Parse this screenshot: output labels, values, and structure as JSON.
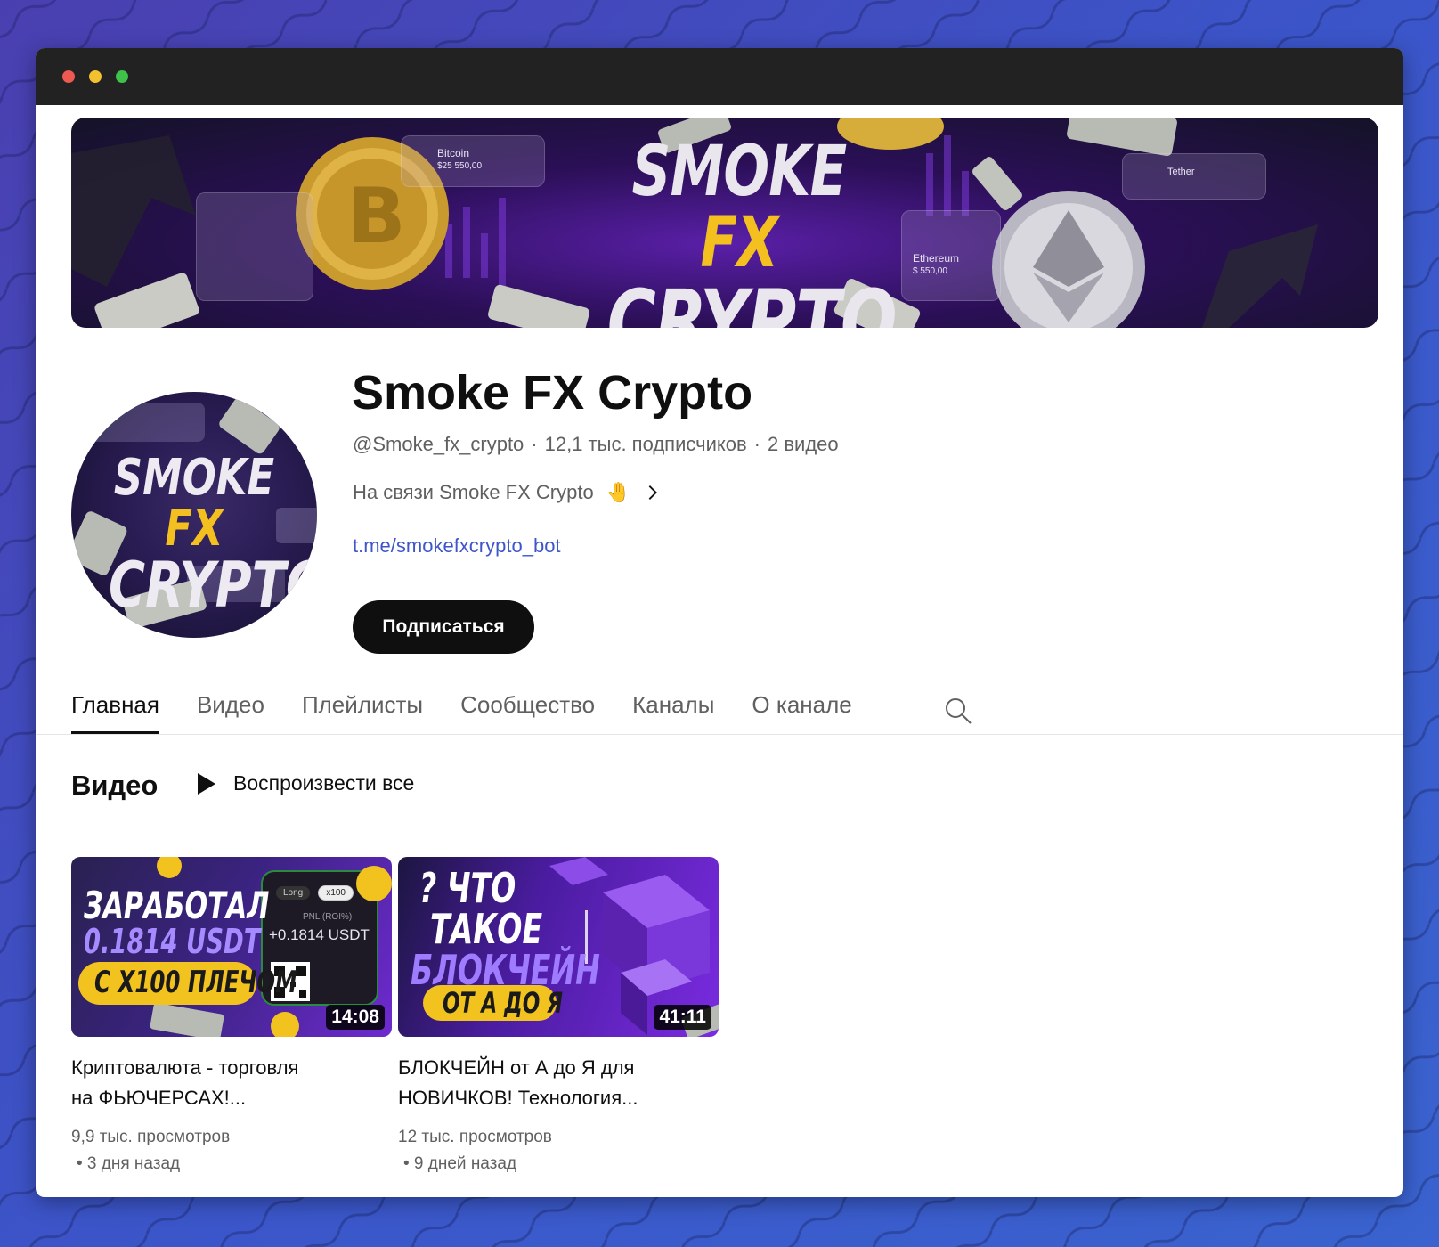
{
  "banner": {
    "title_line1_a": "SMOKE ",
    "title_line1_b": "FX",
    "title_line2": "CRYPTO",
    "card_bitcoin_name": "Bitcoin",
    "card_bitcoin_price": "$25 550,00",
    "card_ethereum_name": "Ethereum",
    "card_ethereum_price": "$ 550,00",
    "card_tether_name": "Tether"
  },
  "avatar": {
    "title_line1_a": "SMOKE ",
    "title_line1_b": "FX",
    "title_line2": "CRYPTO"
  },
  "channel": {
    "name": "Smoke FX Crypto",
    "handle": "@Smoke_fx_crypto",
    "subscribers": "12,1 тыс. подписчиков",
    "videos_count": "2 видео",
    "separator": "·",
    "description": "На связи Smoke FX Crypto",
    "description_emoji": "🤚",
    "link": "t.me/smokefxcrypto_bot",
    "subscribe_label": "Подписаться"
  },
  "tabs": [
    {
      "label": "Главная",
      "active": true
    },
    {
      "label": "Видео"
    },
    {
      "label": "Плейлисты"
    },
    {
      "label": "Сообщество"
    },
    {
      "label": "Каналы"
    },
    {
      "label": "О канале"
    }
  ],
  "section": {
    "title": "Видео",
    "play_all_label": "Воспроизвести все"
  },
  "videos": [
    {
      "thumb_line1": "ЗАРАБОТАЛ",
      "thumb_line2": "0.1814 USDT",
      "thumb_pill": "С X100 ПЛЕЧОМ",
      "thumb_card_long": "Long",
      "thumb_card_x": "x100",
      "thumb_card_pnl_label": "PNL (ROI%)",
      "thumb_card_pnl": "+0.1814 USDT",
      "duration": "14:08",
      "title_line1": "Криптовалюта - торговля",
      "title_line2": "на ФЬЮЧЕРСАХ!...",
      "views": "9,9 тыс. просмотров",
      "age": "• 3 дня назад"
    },
    {
      "thumb_line1": "? ЧТО",
      "thumb_line2": "ТАКОЕ",
      "thumb_line3": "БЛОКЧЕЙН",
      "thumb_pill": "ОТ А ДО Я",
      "duration": "41:11",
      "title_line1": "БЛОКЧЕЙН от А до Я для",
      "title_line2": "НОВИЧКОВ! Технология...",
      "views": "12 тыс. просмотров",
      "age": "• 9 дней назад"
    }
  ],
  "colors": {
    "background": "#3b55c9",
    "accent_link": "#3e56c9",
    "brand_yellow": "#f3c020",
    "brand_purple": "#6e2ad0"
  }
}
